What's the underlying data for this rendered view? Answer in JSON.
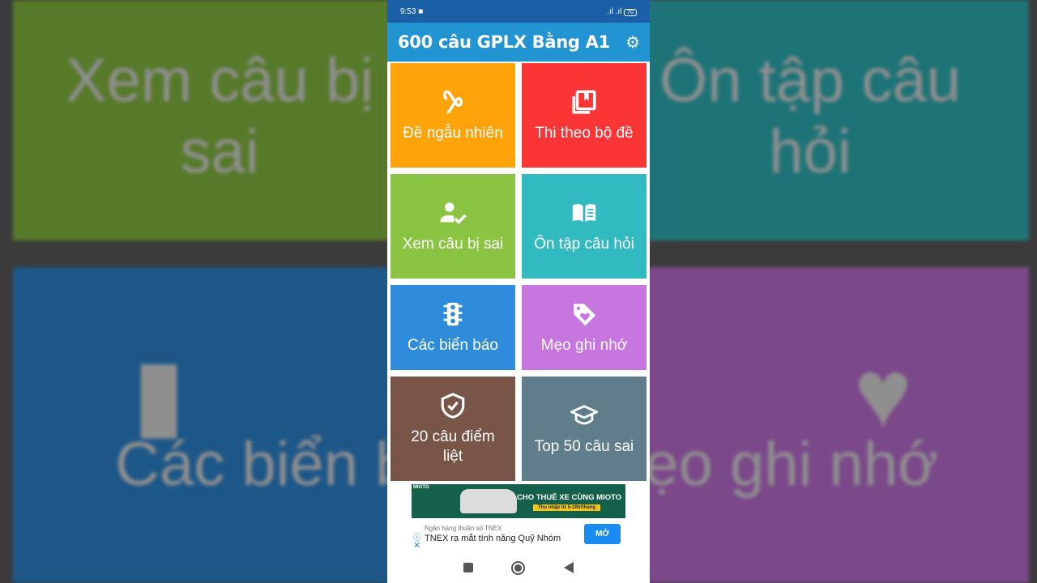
{
  "status": {
    "time": "9:53",
    "battery": "70"
  },
  "app": {
    "title": "600 câu GPLX Bằng A1",
    "settings_icon": "gear-icon"
  },
  "tiles": [
    {
      "label": "Đề ngẫu nhiên",
      "icon": "infinity-icon",
      "color": "#fea40a"
    },
    {
      "label": "Thi theo bộ đề",
      "icon": "bookmark-book-icon",
      "color": "#fb3435"
    },
    {
      "label": "Xem câu bị sai",
      "icon": "user-check-icon",
      "color": "#8bc443"
    },
    {
      "label": "Ôn tập câu hỏi",
      "icon": "open-book-icon",
      "color": "#31bac0"
    },
    {
      "label": "Các biển báo",
      "icon": "traffic-light-icon",
      "color": "#2f8cdb"
    },
    {
      "label": "Mẹo ghi nhớ",
      "icon": "heart-tag-icon",
      "color": "#c775df"
    },
    {
      "label": "20 câu điểm liệt",
      "icon": "shield-check-icon",
      "color": "#795547"
    },
    {
      "label": "Top 50 câu sai",
      "icon": "graduation-cap-icon",
      "color": "#607d8b"
    }
  ],
  "ad": {
    "banner_brand": "MIOTO",
    "banner_title": "CHO THUÊ XE CÙNG MIOTO",
    "banner_sub": "Thu nhập từ 5-10tr/tháng",
    "advertiser": "Ngân hàng thuần số TNEX",
    "headline": "TNEX ra mắt tính năng Quỹ Nhóm",
    "cta": "MỞ"
  }
}
